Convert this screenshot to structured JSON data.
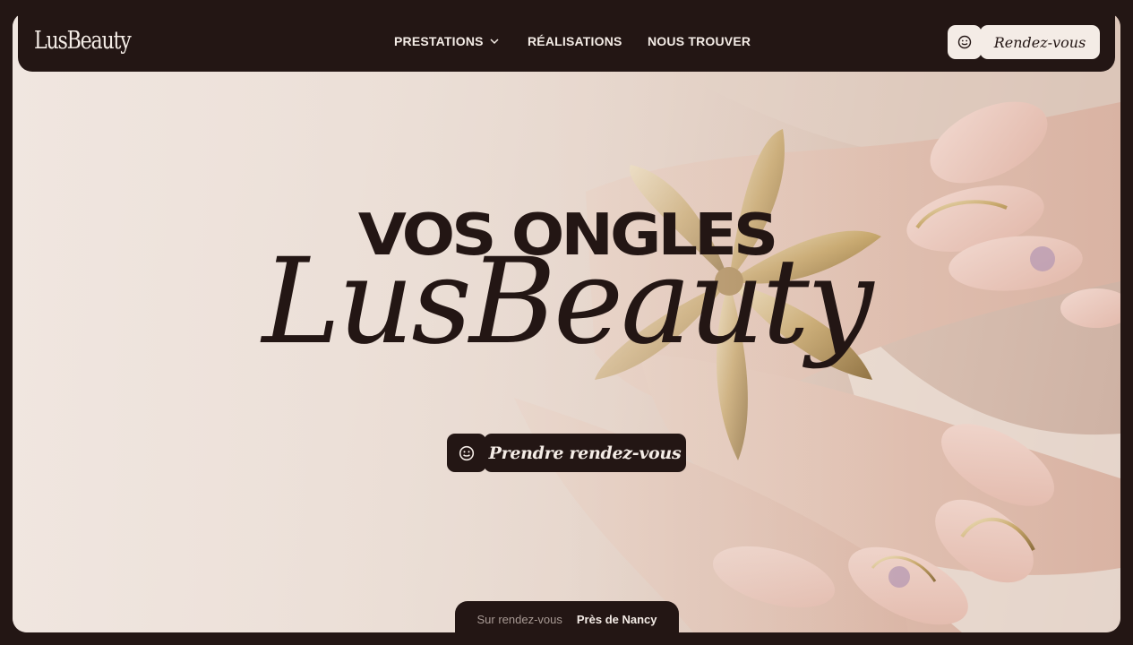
{
  "brand": {
    "logo_text": "LusBeauty"
  },
  "nav": {
    "items": [
      {
        "label": "PRESTATIONS",
        "has_dropdown": true
      },
      {
        "label": "RÉALISATIONS",
        "has_dropdown": false
      },
      {
        "label": "NOUS TROUVER",
        "has_dropdown": false
      }
    ],
    "cta_label": "Rendez-vous",
    "cta_icon": "smiley-icon"
  },
  "hero": {
    "headline": "VOS ONGLES",
    "script_title": "LusBeauty",
    "cta_label": "Prendre rendez-vous",
    "cta_icon": "smiley-icon"
  },
  "footer_tab": {
    "muted": "Sur rendez-vous",
    "strong": "Près de Nancy"
  },
  "colors": {
    "dark": "#231614",
    "cream": "#f4ece6",
    "nail_pink": "#e8c3b6",
    "gold": "#c9a86a"
  }
}
